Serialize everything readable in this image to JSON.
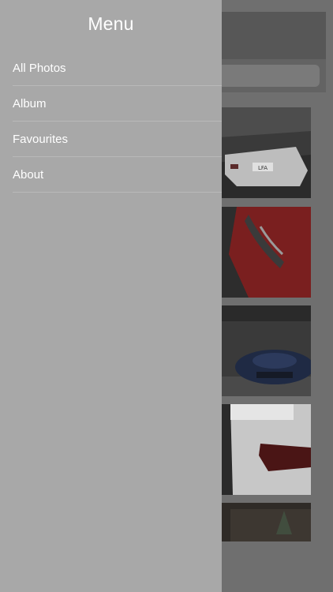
{
  "drawer": {
    "title": "Menu",
    "items": [
      {
        "label": "All Photos"
      },
      {
        "label": "Album"
      },
      {
        "label": "Favourites"
      },
      {
        "label": "About"
      }
    ]
  },
  "gallery": {
    "photos": [
      {
        "subject": "white sports car rear view",
        "plate_text": "LFA"
      },
      {
        "subject": "red car headlight close-up"
      },
      {
        "subject": "blue concept car in warehouse"
      },
      {
        "subject": "white car tail light close-up"
      },
      {
        "subject": "car showroom interior"
      }
    ]
  },
  "colors": {
    "drawer_background": "#a8a8a8",
    "drawer_text": "#ffffff",
    "overlay_background": "#6f6f6f"
  }
}
